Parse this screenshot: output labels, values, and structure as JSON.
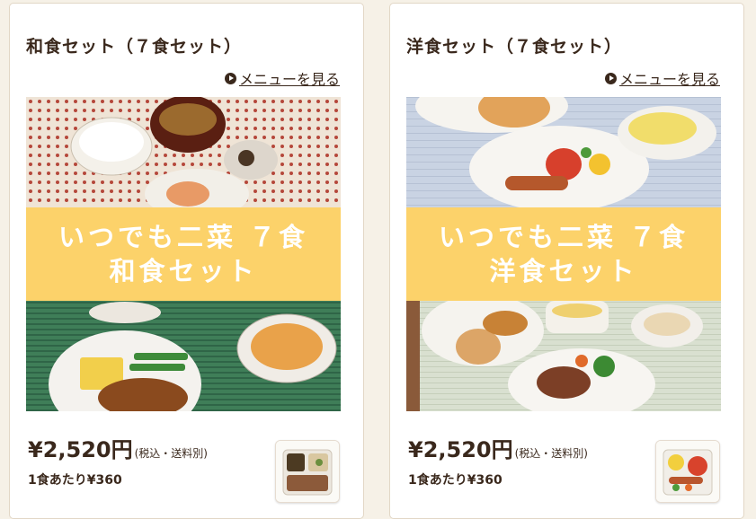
{
  "cards": [
    {
      "title": "和食セット（７食セット）",
      "menu_link": "メニューを見る",
      "banner": {
        "line1": "いつでも二菜 ７食",
        "line2": "和食セット"
      },
      "price": "¥2,520円",
      "price_note": "(税込・送料別)",
      "per_meal": "1食あたり¥360"
    },
    {
      "title": "洋食セット（７食セット）",
      "menu_link": "メニューを見る",
      "banner": {
        "line1": "いつでも二菜 ７食",
        "line2": "洋食セット"
      },
      "price": "¥2,520円",
      "price_note": "(税込・送料別)",
      "per_meal": "1食あたり¥360"
    }
  ],
  "colors": {
    "banner": "#fcd26a",
    "text": "#3a281c",
    "page_bg": "#f6f1e7"
  }
}
